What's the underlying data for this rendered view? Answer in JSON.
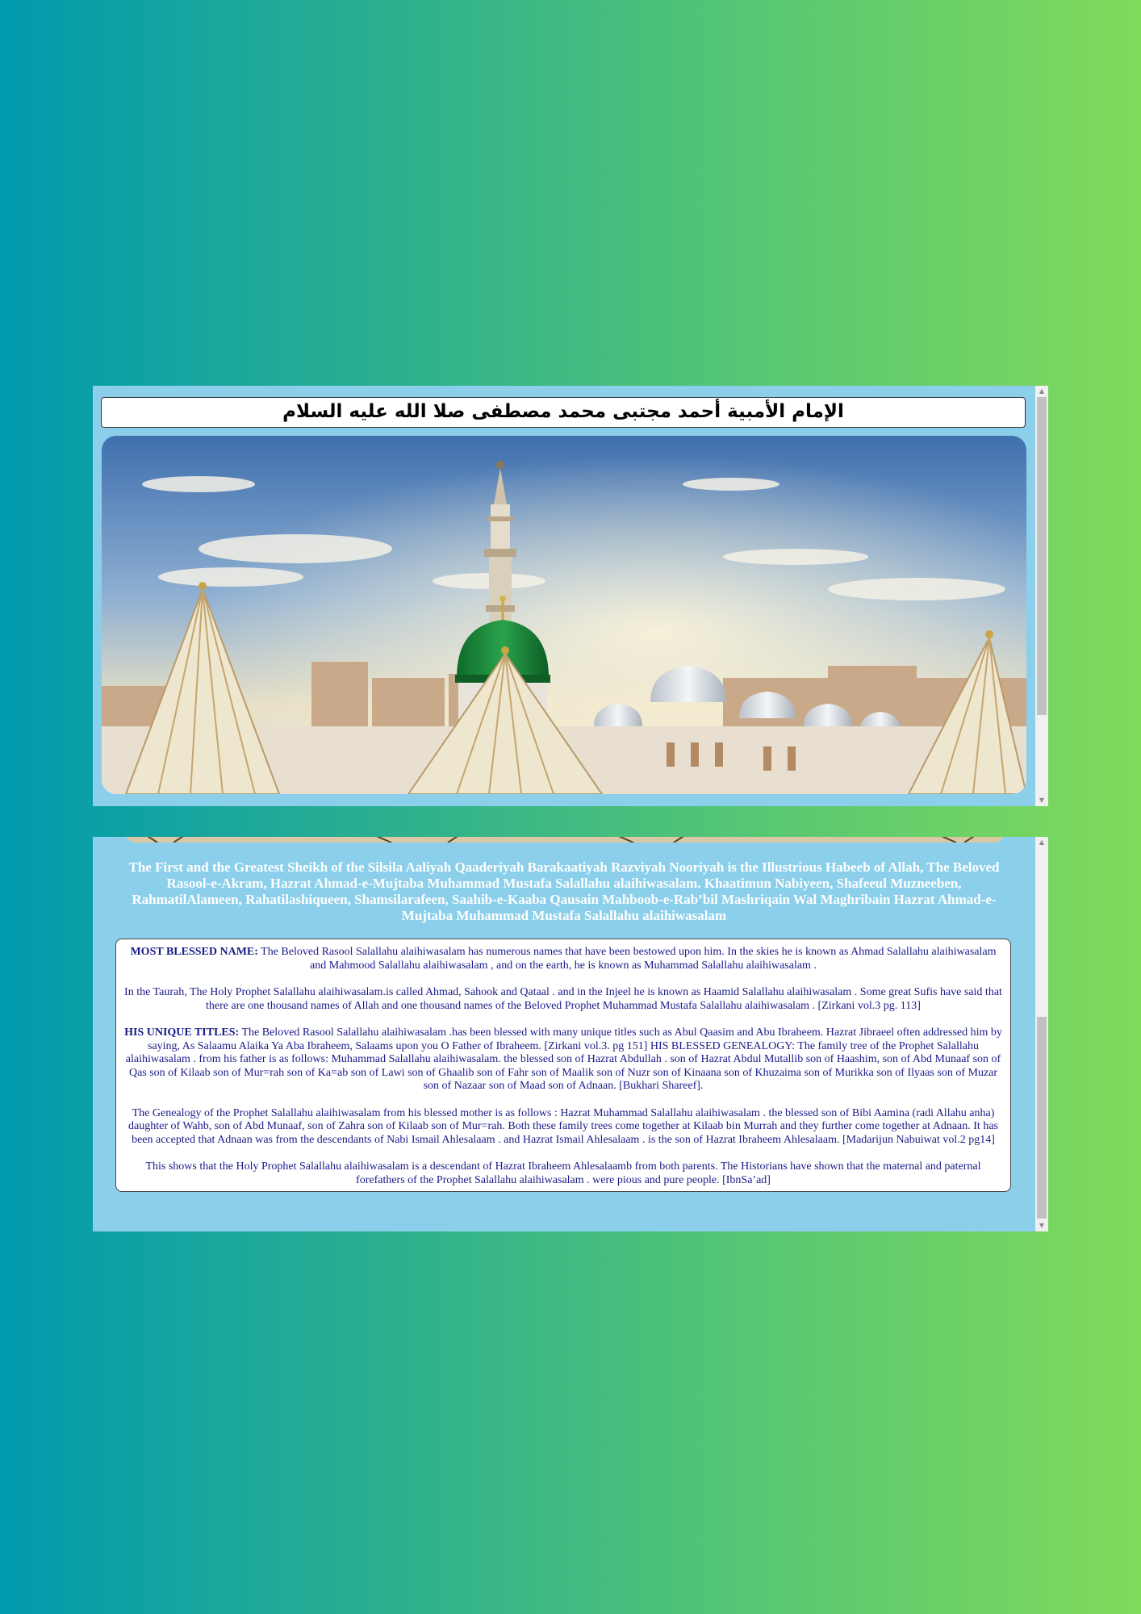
{
  "header": {
    "title": "الإمام الأمبية أحمد مجتبى محمد مصطفى صلا الله عليه السلام"
  },
  "hero_image": {
    "alt": "",
    "colors": {
      "sky_top": "#4e7fb8",
      "sky_bottom": "#e9e2c8",
      "dome": "#1e8a3c",
      "umbrella": "#efe6cf"
    }
  },
  "intro": {
    "text": "The First and the Greatest Sheikh of the Silsila Aaliyah Qaaderiyah Barakaatiyah Razviyah Nooriyah is the Illustrious Habeeb of Allah, The Beloved Rasool-e-Akram, Hazrat Ahmad-e-Mujtaba Muhammad Mustafa Salallahu alaihiwasalam. Khaatimun Nabiyeen, Shafeeul Muzneeben, RahmatilAlameen, Rahatilashiqueen, Shamsilarafeen, Saahib-e-Kaaba Qausain Mahboob-e-Rab’bil Mashriqain Wal Maghribain Hazrat Ahmad-e-Mujtaba Muhammad Mustafa Salallahu alaihiwasalam"
  },
  "content": {
    "p1_label": "MOST BLESSED NAME:",
    "p1_text": " The Beloved Rasool Salallahu alaihiwasalam has numerous names that have been bestowed upon him. In the skies he is known as Ahmad Salallahu alaihiwasalam and Mahmood Salallahu alaihiwasalam , and on the earth, he is known as Muhammad Salallahu alaihiwasalam .",
    "p2_text": "In the Taurah, The Holy Prophet Salallahu alaihiwasalam.is called Ahmad, Sahook and Qataal . and in the Injeel he is known as Haamid Salallahu alaihiwasalam . Some great Sufis have said that there are one thousand names of Allah and one thousand names of the Beloved Prophet Muhammad Mustafa Salallahu alaihiwasalam . [Zirkani vol.3 pg. 113]",
    "p3_label": "HIS UNIQUE TITLES:",
    "p3_text": " The Beloved Rasool Salallahu alaihiwasalam .has been blessed with many unique titles such as Abul Qaasim and Abu Ibraheem. Hazrat Jibraeel often addressed him by saying, As Salaamu Alaika Ya Aba Ibraheem, Salaams upon you O Father of Ibraheem. [Zirkani vol.3. pg 151] HIS BLESSED GENEALOGY: The family tree of the Prophet Salallahu alaihiwasalam . from his father is as follows: Muhammad Salallahu alaihiwasalam. the blessed son of Hazrat Abdullah . son of Hazrat Abdul Mutallib son of Haashim, son of Abd Munaaf son of Qas son of Kilaab son of Mur=rah son of Ka=ab son of Lawi son of Ghaalib son of Fahr son of Maalik son of Nuzr son of Kinaana son of Khuzaima son of Murikka son of Ilyaas son of Muzar son of Nazaar son of Maad son of Adnaan. [Bukhari Shareef].",
    "p4_text": "The Genealogy of the Prophet Salallahu alaihiwasalam from his blessed mother is as follows : Hazrat Muhammad Salallahu alaihiwasalam . the blessed son of Bibi Aamina (radi Allahu anha) daughter of Wahb, son of Abd Munaaf, son of Zahra son of Kilaab son of Mur=rah. Both these family trees come together at Kilaab bin Murrah and they further come together at Adnaan. It has been accepted that Adnaan was from the descendants of Nabi Ismail Ahlesalaam . and Hazrat Ismail Ahlesalaam . is the son of Hazrat Ibraheem Ahlesalaam. [Madarijun Nabuiwat vol.2 pg14]",
    "p5_text": "This shows that the Holy Prophet Salallahu alaihiwasalam is a descendant of Hazrat Ibraheem Ahlesalaamb from both parents. The Historians have shown that the maternal and paternal forefathers of the Prophet Salallahu alaihiwasalam . were pious and pure people. [IbnSa’ad]"
  },
  "scroll": {
    "up_arrow": "▲",
    "down_arrow": "▼"
  }
}
